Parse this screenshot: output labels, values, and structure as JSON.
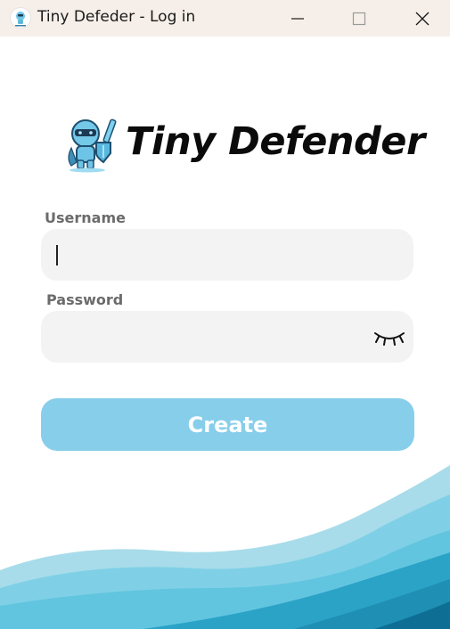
{
  "window": {
    "title": "Tiny Defeder - Log in",
    "controls": {
      "minimize_icon": "minimize-icon",
      "maximize_icon": "maximize-icon",
      "close_icon": "close-icon"
    }
  },
  "brand": {
    "name": "Tiny Defender",
    "logo_icon": "robot-knight-mascot"
  },
  "form": {
    "username": {
      "label": "Username",
      "value": "",
      "placeholder": ""
    },
    "password": {
      "label": "Password",
      "value": "",
      "placeholder": "",
      "toggle_icon": "eye-closed-icon"
    },
    "submit_label": "Create"
  },
  "colors": {
    "titlebar_bg": "#f6efe9",
    "input_bg": "#f3f3f3",
    "button_bg": "#87ceeb",
    "button_text": "#ffffff",
    "label_text": "#6b6b6b",
    "wave_light": "#a8dcea",
    "wave_mid": "#5fc3de",
    "wave_dark": "#1f8fb3",
    "wave_deep": "#0f6e94"
  }
}
